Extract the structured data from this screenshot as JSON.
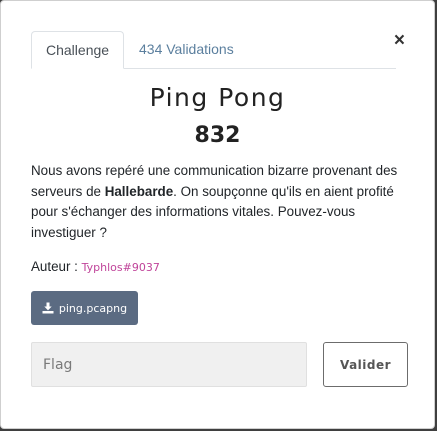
{
  "tabs": [
    {
      "label": "Challenge",
      "active": true
    },
    {
      "label": "434 Validations",
      "active": false
    }
  ],
  "close_label": "×",
  "challenge": {
    "name": "Ping Pong",
    "points": "832",
    "description": {
      "part1": "Nous avons repéré une communication bizarre provenant des serveurs de ",
      "bold": "Hallebarde",
      "part2": ". On soupçonne qu'ils en aient profité pour s'échanger des informations vitales. Pouvez-vous investiguer ?"
    },
    "author_label": "Auteur :",
    "author_handle": "Typhlos#9037",
    "file_label": "ping.pcapng",
    "file_icon": "download-icon"
  },
  "form": {
    "flag_placeholder": "Flag",
    "flag_value": "",
    "submit_label": "Valider"
  },
  "colors": {
    "link": "#5b7f9e",
    "author": "#c0449a",
    "file_button": "#5b6b82"
  }
}
